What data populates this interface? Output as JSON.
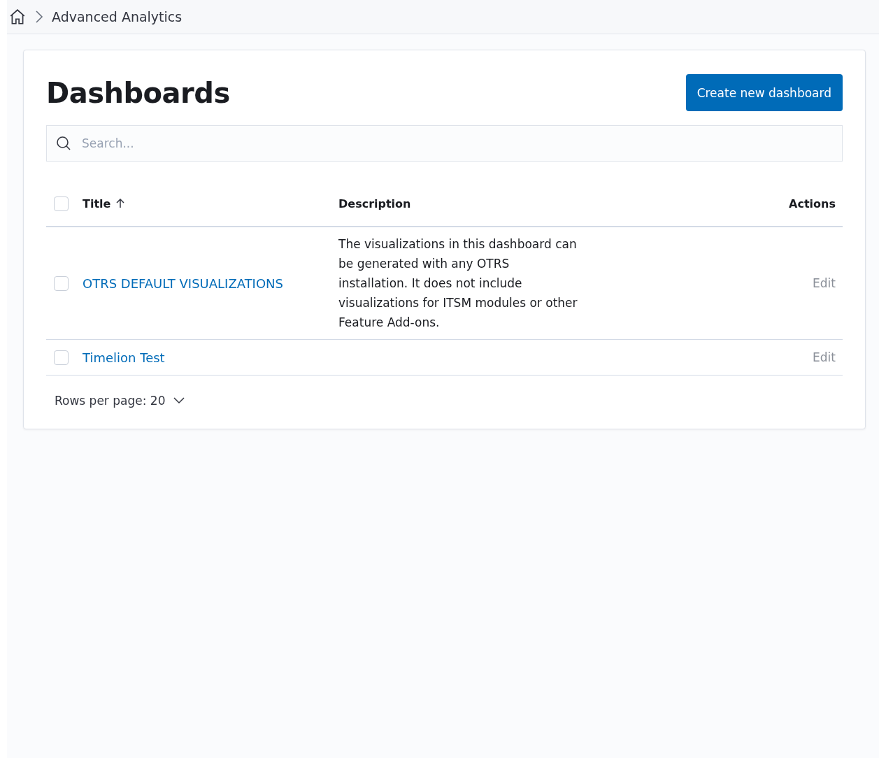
{
  "breadcrumb": {
    "items": [
      {
        "label": "Advanced Analytics"
      }
    ]
  },
  "page": {
    "title": "Dashboards",
    "create_button": "Create new dashboard"
  },
  "search": {
    "placeholder": "Search..."
  },
  "table": {
    "select_all": {
      "checked": false
    },
    "columns": [
      {
        "label": "Title",
        "sorted": true
      },
      {
        "label": "Description"
      },
      {
        "label": "Actions"
      }
    ],
    "rows": [
      {
        "checked": false,
        "title": "OTRS DEFAULT VISUALIZATIONS",
        "description": "The visualizations in this dashboard can be generated with any OTRS installation. It does not include visualizations for ITSM modules or other Feature Add-ons.",
        "action": "Edit"
      },
      {
        "checked": false,
        "title": "Timelion Test",
        "action": "Edit"
      }
    ]
  },
  "pagination": {
    "label": "Rows per page: 20"
  }
}
